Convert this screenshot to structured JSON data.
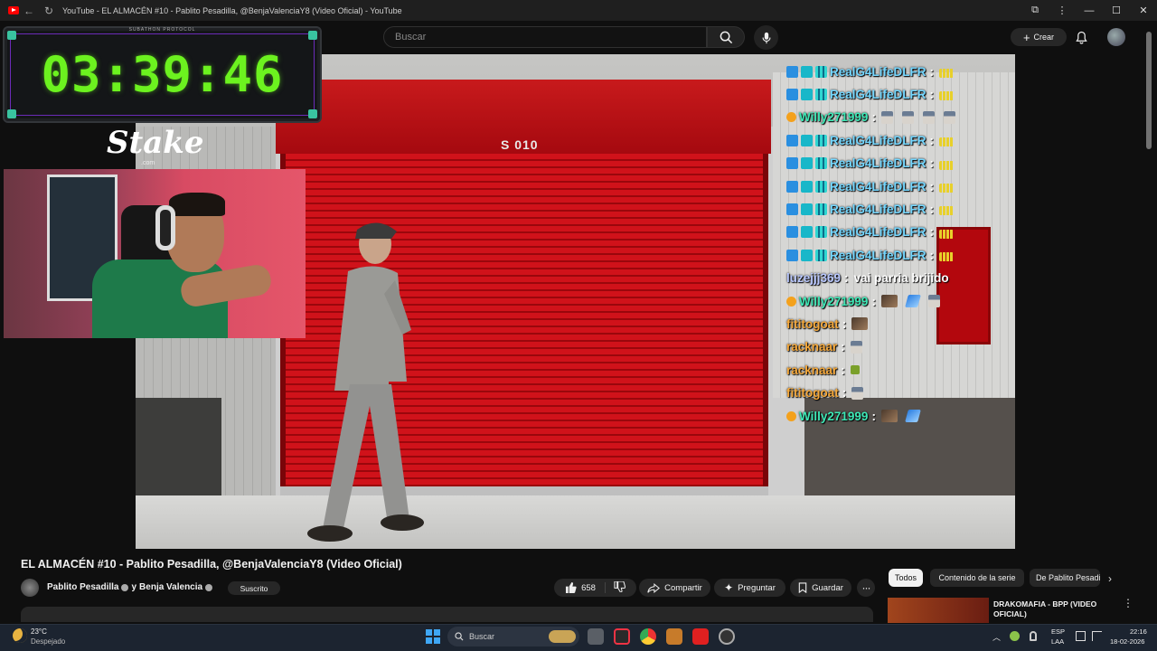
{
  "browser": {
    "tab_title": "YouTube - EL ALMACÉN #10 - Pablito Pesadilla, @BenjaValenciaY8 (Video Oficial) - YouTube"
  },
  "header": {
    "search_placeholder": "Buscar",
    "create_label": "Crear"
  },
  "overlay": {
    "timer_caption": "SUBATHON PROTOCOL",
    "timer_value": "03:39:46",
    "sponsor_logo": "Stake",
    "sponsor_sub": ".com"
  },
  "video_scene": {
    "unit_label": "S 010"
  },
  "chat": [
    {
      "user": "RealG4LifeDLFR",
      "color": "#74d7ff",
      "badges": [
        "blue",
        "cyan",
        "grid"
      ],
      "msg": "",
      "emotes": [
        "bars"
      ]
    },
    {
      "user": "RealG4LifeDLFR",
      "color": "#74d7ff",
      "badges": [
        "blue",
        "cyan",
        "grid"
      ],
      "msg": "",
      "emotes": [
        "bars"
      ]
    },
    {
      "user": "Willy271999",
      "color": "#3ee8b6",
      "badges": [
        "orange"
      ],
      "msg": "",
      "emotes": [
        "person",
        "person",
        "person",
        "person"
      ]
    },
    {
      "user": "RealG4LifeDLFR",
      "color": "#74d7ff",
      "badges": [
        "blue",
        "cyan",
        "grid"
      ],
      "msg": "",
      "emotes": [
        "bars"
      ]
    },
    {
      "user": "RealG4LifeDLFR",
      "color": "#74d7ff",
      "badges": [
        "blue",
        "cyan",
        "grid"
      ],
      "msg": "",
      "emotes": [
        "bars"
      ]
    },
    {
      "user": "RealG4LifeDLFR",
      "color": "#74d7ff",
      "badges": [
        "blue",
        "cyan",
        "grid"
      ],
      "msg": "",
      "emotes": [
        "bars"
      ]
    },
    {
      "user": "RealG4LifeDLFR",
      "color": "#74d7ff",
      "badges": [
        "blue",
        "cyan",
        "grid"
      ],
      "msg": "",
      "emotes": [
        "bars"
      ]
    },
    {
      "user": "RealG4LifeDLFR",
      "color": "#74d7ff",
      "badges": [
        "blue",
        "cyan",
        "grid"
      ],
      "msg": "",
      "emotes": [
        "bars"
      ]
    },
    {
      "user": "RealG4LifeDLFR",
      "color": "#74d7ff",
      "badges": [
        "blue",
        "cyan",
        "grid"
      ],
      "msg": "",
      "emotes": [
        "bars"
      ]
    },
    {
      "user": "luzejjj369",
      "color": "#b9c8ff",
      "badges": [],
      "msg": "vai parria brijido",
      "emotes": []
    },
    {
      "user": "Willy271999",
      "color": "#3ee8b6",
      "badges": [
        "orange"
      ],
      "msg": "",
      "emotes": [
        "photo",
        "blue",
        "person"
      ]
    },
    {
      "user": "fititogoat",
      "color": "#f6a93b",
      "badges": [],
      "msg": "",
      "emotes": [
        "photo"
      ]
    },
    {
      "user": "racknaar",
      "color": "#f6a93b",
      "badges": [],
      "msg": "",
      "emotes": [
        "person"
      ]
    },
    {
      "user": "racknaar",
      "color": "#f6a93b",
      "badges": [],
      "msg": "",
      "emotes": [
        "green"
      ]
    },
    {
      "user": "fititogoat",
      "color": "#f6a93b",
      "badges": [],
      "msg": "",
      "emotes": [
        "person"
      ]
    },
    {
      "user": "Willy271999",
      "color": "#3ee8b6",
      "badges": [
        "orange"
      ],
      "msg": "",
      "emotes": [
        "photo",
        "blue"
      ]
    }
  ],
  "video": {
    "title": "EL ALMACÉN #10 - Pablito Pesadilla, @BenjaValenciaY8 (Video Oficial)",
    "channel_1": "Pablito Pesadilla",
    "channel_joiner": "y",
    "channel_2": "Benja Valencia",
    "subscribed_label": "Suscrito",
    "likes": "658",
    "share_label": "Compartir",
    "ask_label": "Preguntar",
    "save_label": "Guardar"
  },
  "sidebar": {
    "chips": [
      "Todos",
      "Contenido de la serie",
      "De Pablito Pesadilla"
    ],
    "recommended_title": "DRAKOMAFIA - BPP (VIDEO OFICIAL)"
  },
  "taskbar": {
    "weather_temp": "23°C",
    "weather_desc": "Despejado",
    "search_label": "Buscar",
    "lang_1": "ESP",
    "lang_2": "LAA",
    "time": "22:16",
    "date": "18-02-2026"
  },
  "colors": {
    "timer_green": "#6cf21f",
    "timer_frame": "#6b2bb8",
    "shutter_red": "#d0121a",
    "yt_bg": "#0f0f0f"
  }
}
